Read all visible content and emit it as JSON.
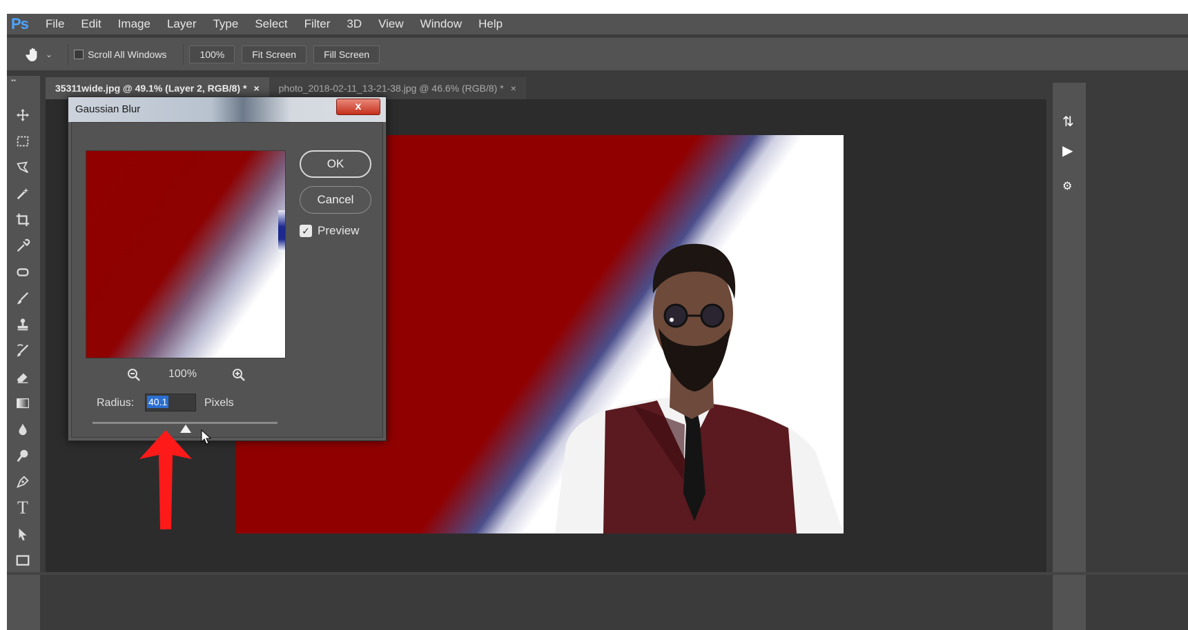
{
  "app": {
    "logo": "Ps",
    "menu": [
      "File",
      "Edit",
      "Image",
      "Layer",
      "Type",
      "Select",
      "Filter",
      "3D",
      "View",
      "Window",
      "Help"
    ]
  },
  "options": {
    "scroll_all_windows": "Scroll All Windows",
    "zoom_100": "100%",
    "fit_screen": "Fit Screen",
    "fill_screen": "Fill Screen"
  },
  "tabs": [
    {
      "label": "35311wide.jpg @ 49.1% (Layer 2, RGB/8) *",
      "close": "×"
    },
    {
      "label": "photo_2018-02-11_13-21-38.jpg @ 46.6% (RGB/8) *",
      "close": "×"
    }
  ],
  "dialog": {
    "title": "Gaussian Blur",
    "close": "x",
    "ok": "OK",
    "cancel": "Cancel",
    "preview": "Preview",
    "preview_checked": true,
    "zoom_level": "100%",
    "radius_label": "Radius:",
    "radius_value": "40.1",
    "unit": "Pixels"
  },
  "colors": {
    "accent_red": "#900000",
    "annotation_arrow": "#ff1a1a",
    "ps_blue": "#4da3ff"
  },
  "icons": [
    "hand-icon",
    "move-icon",
    "marquee-icon",
    "lasso-icon",
    "magic-wand-icon",
    "crop-icon",
    "eyedropper-icon",
    "healing-icon",
    "brush-icon",
    "stamp-icon",
    "history-brush-icon",
    "eraser-icon",
    "gradient-icon",
    "blur-icon",
    "dodge-icon",
    "pen-icon",
    "type-icon",
    "path-select-icon",
    "rectangle-icon",
    "zoom-out-icon",
    "zoom-in-icon"
  ]
}
